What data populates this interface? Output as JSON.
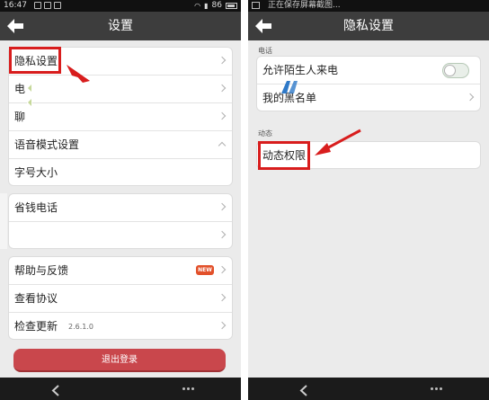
{
  "left_screen": {
    "status_bar": {
      "time": "16:47",
      "battery": "86"
    },
    "title": "设置",
    "group1": [
      {
        "label": "隐私设置"
      },
      {
        "label": "电"
      },
      {
        "label": "聊"
      },
      {
        "label": "语音模式设置"
      },
      {
        "label": "字号大小"
      }
    ],
    "group2": [
      {
        "label": "省钱电话"
      },
      {
        "label": ""
      }
    ],
    "group3": [
      {
        "label": "帮助与反馈",
        "badge": "NEW"
      },
      {
        "label": "查看协议"
      },
      {
        "label": "检查更新",
        "version": "2.6.1.0"
      }
    ],
    "logout_label": "退出登录"
  },
  "right_screen": {
    "status_bar": {
      "notice": "正在保存屏幕截图..."
    },
    "title": "隐私设置",
    "section_phone": "电话",
    "phone_rows": [
      {
        "label": "允许陌生人来电",
        "toggle_on": false
      },
      {
        "label": "我的黑名单"
      }
    ],
    "section_moments": "动态",
    "moments_rows": [
      {
        "label": "动态权限"
      }
    ]
  },
  "colors": {
    "title_bar": "#3d3d3d",
    "highlight": "#d81d1d",
    "logout_button": "#c9474c",
    "new_badge": "#e2502a"
  },
  "icons": [
    "back-arrow-icon",
    "chevron-right-icon",
    "nav-back-icon",
    "nav-menu-icon"
  ]
}
